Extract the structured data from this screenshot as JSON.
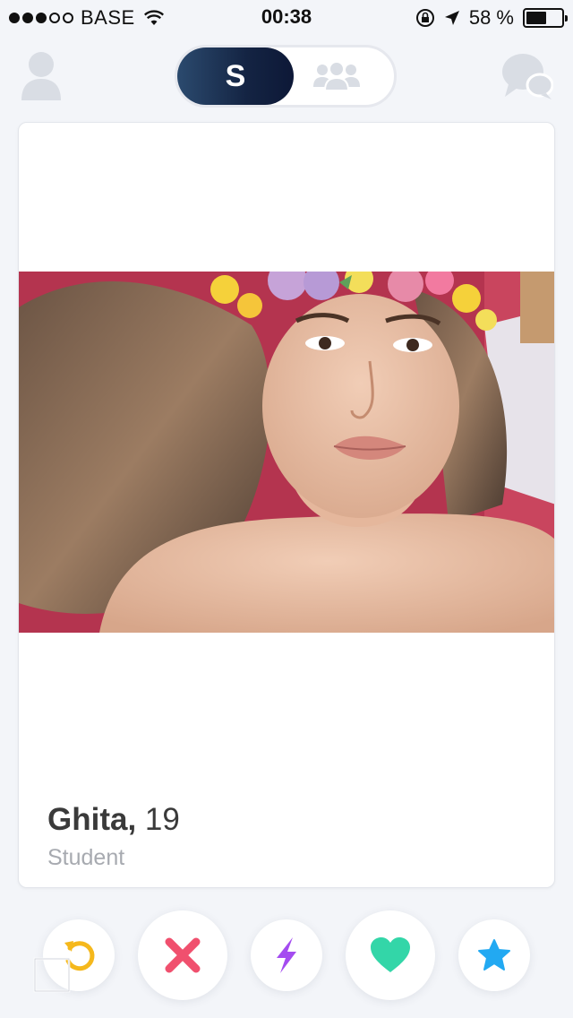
{
  "status_bar": {
    "carrier": "BASE",
    "signal_bars_filled": 3,
    "signal_bars_total": 5,
    "time": "00:38",
    "battery_percent": "58 %",
    "battery_level": 0.58
  },
  "nav": {
    "toggle_active_label": "S",
    "icons": {
      "profile": "person-icon",
      "group": "group-icon",
      "messages": "chat-bubbles-icon"
    }
  },
  "card": {
    "name": "Ghita,",
    "age": "19",
    "occupation": "Student"
  },
  "actions": {
    "rewind": {
      "icon": "rewind-icon",
      "color": "#f5b81c"
    },
    "nope": {
      "icon": "close-icon",
      "color": "#f0506e"
    },
    "boost": {
      "icon": "lightning-icon",
      "color": "#a44cf0"
    },
    "like": {
      "icon": "heart-icon",
      "color": "#33d6a8"
    },
    "super_like": {
      "icon": "star-icon",
      "color": "#22a9f2"
    }
  },
  "colors": {
    "toggle_dark": "#142443",
    "inactive_icon": "#d9dde4",
    "background": "#f3f5f9"
  }
}
